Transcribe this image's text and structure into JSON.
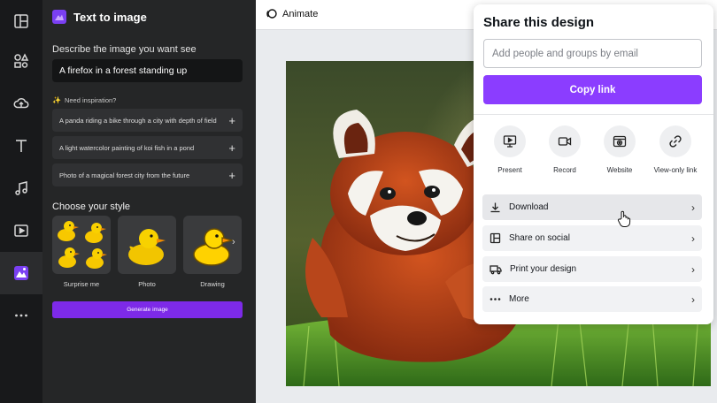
{
  "panel": {
    "title": "Text to image",
    "describe_label": "Describe the image you want see",
    "prompt_value": "A firefox in a forest standing up",
    "inspiration_label": "Need inspiration?",
    "inspirations": [
      "A panda riding a bike through a city with depth of field",
      "A light watercolor painting of koi fish in a pond",
      "Photo of a magical forest city from the future"
    ],
    "style_title": "Choose your style",
    "styles": [
      "Surprise me",
      "Photo",
      "Drawing"
    ],
    "generate_label": "Generate image"
  },
  "toolbar": {
    "animate_label": "Animate"
  },
  "share": {
    "title": "Share this design",
    "email_placeholder": "Add people and groups by email",
    "copy_link_label": "Copy link",
    "options": [
      "Present",
      "Record",
      "Website",
      "View-only link"
    ],
    "rows": [
      "Download",
      "Share on social",
      "Print your design",
      "More"
    ]
  },
  "colors": {
    "accent": "#8b3dff",
    "generate_button": "#7d2ae8",
    "panel_bg": "#252627",
    "rail_bg": "#18191b"
  },
  "icons": {
    "rail": [
      "layout-icon",
      "elements-icon",
      "upload-icon",
      "text-icon",
      "audio-icon",
      "video-icon",
      "text-to-image-app-icon",
      "more-icon"
    ],
    "share_options": [
      "present-icon",
      "record-icon",
      "website-icon",
      "link-icon"
    ],
    "share_rows": [
      "download-icon",
      "share-social-icon",
      "print-icon",
      "more-dots-icon"
    ]
  }
}
